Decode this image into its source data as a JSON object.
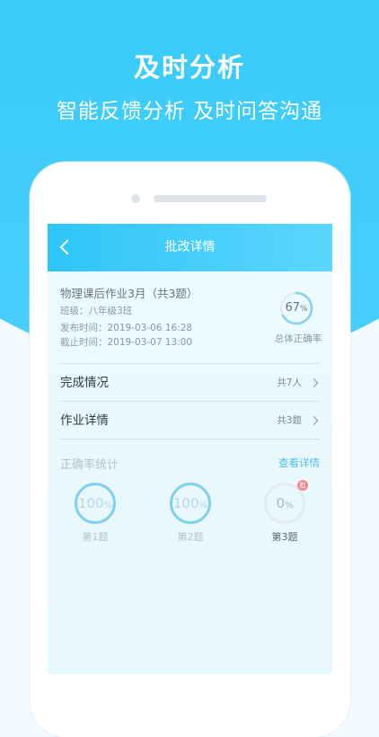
{
  "promo": {
    "headline": "及时分析",
    "subline": "智能反馈分析  及时问答沟通"
  },
  "colors": {
    "brand_blue": "#2fc7f7",
    "ring_blue": "#7fd1f2",
    "ring_track": "#e3ebf0",
    "link_blue": "#4ec1ee",
    "badge_red": "#f08a8a"
  },
  "nav": {
    "back_icon": "chevron-left-icon",
    "title": "批改详情"
  },
  "homework": {
    "title": "物理课后作业3月（共3题）",
    "class": "班级：八年级3班",
    "publish_time": "发布时间：2019-03-06 16:28",
    "deadline": "截止时间：2019-03-07 13:00",
    "overall_value": "67",
    "overall_unit": "%",
    "overall_fraction": 0.67,
    "overall_label": "总体正确率"
  },
  "rows": [
    {
      "label": "完成情况",
      "value": "共7人"
    },
    {
      "label": "作业详情",
      "value": "共3题"
    }
  ],
  "stats": {
    "title": "正确率统计",
    "link": "查看详情",
    "questions": [
      {
        "label": "第1题",
        "value": "100",
        "unit": "%",
        "fraction": 1.0
      },
      {
        "label": "第2题",
        "value": "100",
        "unit": "%",
        "fraction": 1.0
      },
      {
        "label": "第3题",
        "value": "0",
        "unit": "%",
        "fraction": 0.0,
        "badge": "批"
      }
    ]
  }
}
